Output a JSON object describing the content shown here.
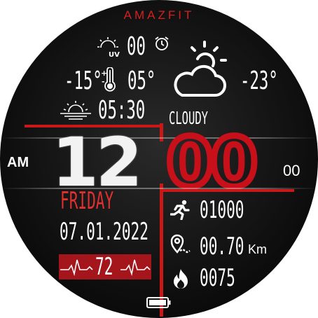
{
  "brand": "AMAZFIT",
  "weather": {
    "uv_value": "00",
    "temp_low": "-15°",
    "temp_high": "05°",
    "current_temp": "-23°",
    "sunrise": "05:30",
    "condition": "CLOUDY"
  },
  "time": {
    "ampm": "AM",
    "hours": "12",
    "minutes": "00",
    "seconds": "00"
  },
  "date": {
    "weekday": "FRIDAY",
    "date": "07.01.2022"
  },
  "heart_rate": "72",
  "activity": {
    "steps": "01000",
    "distance": "00.70",
    "distance_unit": "Km",
    "calories": "0075"
  },
  "colors": {
    "accent": "#c8101a",
    "brand": "#d52020"
  },
  "icons": [
    "uv-sun-icon",
    "alarm-icon",
    "thermometer-icon",
    "sunrise-icon",
    "cloudy-weather-icon",
    "running-icon",
    "location-pin-icon",
    "flame-icon",
    "battery-icon",
    "heart-ecg-icon"
  ]
}
